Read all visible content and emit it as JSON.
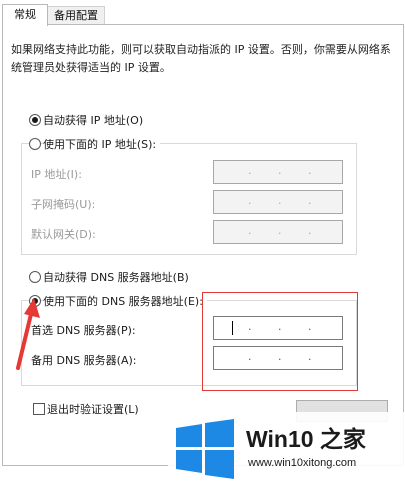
{
  "tabs": {
    "general": "常规",
    "alternate": "备用配置"
  },
  "description": "如果网络支持此功能，则可以获取自动指派的 IP 设置。否则，你需要从网络系统管理员处获得适当的 IP 设置。",
  "ip": {
    "auto_label": "自动获得 IP 地址(O)",
    "manual_label": "使用下面的 IP 地址(S):",
    "auto_selected": true,
    "fields": [
      {
        "label": "IP 地址(I):",
        "value": "   .   .   ."
      },
      {
        "label": "子网掩码(U):",
        "value": "   .   .   ."
      },
      {
        "label": "默认网关(D):",
        "value": "   .   .   ."
      }
    ]
  },
  "dns": {
    "auto_label": "自动获得 DNS 服务器地址(B)",
    "manual_label": "使用下面的 DNS 服务器地址(E):",
    "manual_selected": true,
    "fields": [
      {
        "label": "首选 DNS 服务器(P):",
        "value": "   .   .   ."
      },
      {
        "label": "备用 DNS 服务器(A):",
        "value": "   .   .   ."
      }
    ]
  },
  "validate_label": "退出时验证设置(L)",
  "watermark": {
    "title": "Win10 之家",
    "url": "www.win10xitong.com",
    "colors": {
      "logo": "#1e88e5",
      "arrow": "#e53935",
      "highlight": "#e03a3a"
    }
  }
}
